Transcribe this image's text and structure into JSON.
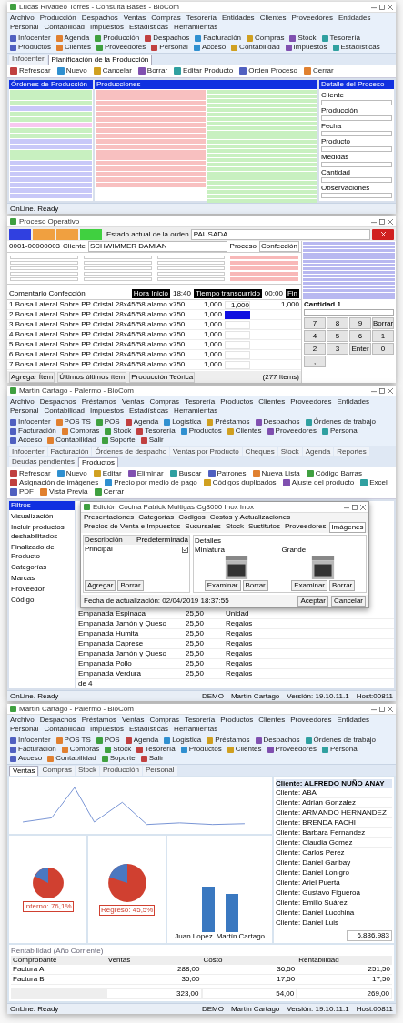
{
  "production_window": {
    "title": "Lucas Rivadeo Torres - Consulta Bases - BioCom",
    "menu": [
      "Archivo",
      "Producción",
      "Despachos",
      "Ventas",
      "Compras",
      "Tesorería",
      "Entidades",
      "Clientes",
      "Proveedores",
      "Entidades",
      "Personal",
      "Contabilidad",
      "Impuestos",
      "Estadísticas",
      "Herramientas"
    ],
    "toolbar": [
      "Infocenter",
      "Agenda",
      "Producción",
      "Despachos",
      "Facturación",
      "Compras",
      "Stock",
      "Tesorería",
      "Productos",
      "Clientes",
      "Proveedores",
      "Personal",
      "Acceso",
      "Contabilidad",
      "Impuestos",
      "Estadísticas"
    ],
    "tabs": [
      {
        "label": "Infocenter",
        "selected": false
      },
      {
        "label": "Planificación de la Producción",
        "selected": true
      }
    ],
    "ribbon": [
      "Refrescar",
      "Nuevo",
      "Cancelar",
      "Borrar",
      "Editar Producto",
      "Orden Proceso",
      "Cerrar"
    ],
    "panels": [
      "Órdenes de Producción",
      "Producciones",
      "Detalle del Proceso"
    ],
    "orders": [
      {
        "color": "#c8f0c0"
      },
      {
        "color": "#c8f0c0"
      },
      {
        "color": "#c8f0c0"
      },
      {
        "color": "#c8c8f8"
      },
      {
        "color": "#c8f0c0"
      },
      {
        "color": "#c8f0c0"
      },
      {
        "color": "#f8c8f0"
      },
      {
        "color": "#c8f0c0"
      },
      {
        "color": "#c8f0c0"
      },
      {
        "color": "#c8c8f8"
      },
      {
        "color": "#c8c8f8"
      },
      {
        "color": "#c8f0c0"
      },
      {
        "color": "#c8f0c0"
      },
      {
        "color": "#c8c8f8"
      },
      {
        "color": "#c8c8f8"
      },
      {
        "color": "#c8c8f8"
      },
      {
        "color": "#c8c8f8"
      },
      {
        "color": "#c8c8f8"
      },
      {
        "color": "#c8c8f8"
      },
      {
        "color": "#c8c8f8"
      }
    ],
    "detail_fields": [
      "Cliente",
      "Producción",
      "Fecha",
      "Producto",
      "Medidas",
      "Cantidad",
      "Observaciones"
    ],
    "status_bar": "OnLine. Ready"
  },
  "operative_window": {
    "title": "Proceso Operativo",
    "state_buttons": [
      {
        "color": "#3040e0"
      },
      {
        "color": "#f0a040"
      },
      {
        "color": "#f0a040"
      },
      {
        "color": "#40d040"
      }
    ],
    "state_label": "Estado actual de la orden",
    "state_value": "PAUSADA",
    "order": "0001-00000003",
    "client_label": "Cliente",
    "client": "SCHWIMMER DAMIAN",
    "process_label": "Proceso",
    "process": "Confección",
    "comment": "Comentario Confección",
    "start_label": "Hora Inicio",
    "start": "18:40",
    "elapsed_label": "Tiempo transcurrido",
    "elapsed": "00:00",
    "end_label": "Fin",
    "lines": [
      {
        "item": "1 Bolsa Lateral Sobre PP Cristal 28x45/58 alamo x750",
        "qty": "1,000",
        "done": "1,000",
        "total": "1,000",
        "selected": false
      },
      {
        "item": "2 Bolsa Lateral Sobre PP Cristal 28x45/58 alamo x750",
        "qty": "1,000",
        "selected": true
      },
      {
        "item": "3 Bolsa Lateral Sobre PP Cristal 28x45/58 alamo x750",
        "qty": "1,000",
        "selected": false
      },
      {
        "item": "4 Bolsa Lateral Sobre PP Cristal 28x45/58 alamo x750",
        "qty": "1,000",
        "selected": false
      },
      {
        "item": "5 Bolsa Lateral Sobre PP Cristal 28x45/58 alamo x750",
        "qty": "1,000",
        "selected": false
      },
      {
        "item": "6 Bolsa Lateral Sobre PP Cristal 28x45/58 alamo x750",
        "qty": "1,000",
        "selected": false
      },
      {
        "item": "7 Bolsa Lateral Sobre PP Cristal 28x45/58 alamo x750",
        "qty": "1,000",
        "selected": false
      }
    ],
    "footer_tabs": [
      "Agregar Ítem",
      "Últimos últimos ítem",
      "Producción Teórica"
    ],
    "item_count": "(277 Items)",
    "keypad_label": "Cantidad 1",
    "keys": [
      "7",
      "8",
      "9",
      "Borrar",
      "4",
      "5",
      "6",
      "1",
      "2",
      "3",
      "Enter",
      "0",
      ","
    ]
  },
  "products_window": {
    "title": "Martín Cartago - Palermo - BioCom",
    "menu": [
      "Archivo",
      "Despachos",
      "Préstamos",
      "Ventas",
      "Compras",
      "Tesorería",
      "Productos",
      "Clientes",
      "Proveedores",
      "Entidades",
      "Personal",
      "Contabilidad",
      "Impuestos",
      "Estadísticas",
      "Herramientas"
    ],
    "toolbar": [
      "Infocenter",
      "POS TS",
      "POS",
      "Agenda",
      "Logística",
      "Préstamos",
      "Despachos",
      "Órdenes de trabajo",
      "Facturación",
      "Compras",
      "Stock",
      "Tesorería",
      "Productos",
      "Clientes",
      "Proveedores",
      "Personal",
      "Acceso",
      "Contabilidad",
      "Soporte",
      "Salir"
    ],
    "tabs": [
      {
        "label": "Infocenter",
        "selected": false
      },
      {
        "label": "Facturación",
        "selected": false
      },
      {
        "label": "Órdenes de despacho",
        "selected": false
      },
      {
        "label": "Ventas por Producto",
        "selected": false
      },
      {
        "label": "Cheques",
        "selected": false
      },
      {
        "label": "Stock",
        "selected": false
      },
      {
        "label": "Agenda",
        "selected": false
      },
      {
        "label": "Reportes",
        "selected": false
      },
      {
        "label": "Deudas pendientes",
        "selected": false
      },
      {
        "label": "Productos",
        "selected": true
      }
    ],
    "ribbon": [
      "Refrescar",
      "Nuevo",
      "Editar",
      "Eliminar",
      "Buscar",
      "Patrones",
      "Nueva Lista",
      "Código Barras",
      "Asignación de imágenes",
      "Precio por medio de pago",
      "Códigos duplicados",
      "Ajuste del producto",
      "Excel",
      "PDF",
      "Vista Previa",
      "Cerrar"
    ],
    "filters": [
      "Filtros",
      "Visualización",
      "Incluir productos deshabilitados",
      "Finalizado del Producto",
      "Categorías",
      "Marcas",
      "Proveedor",
      "Código"
    ],
    "dialog": {
      "title": "Edición Cocina Patrick Multigas Cg8050 Inox Inox",
      "tabs": [
        {
          "label": "Presentaciones",
          "selected": false
        },
        {
          "label": "Categorías",
          "selected": false
        },
        {
          "label": "Códigos",
          "selected": false
        },
        {
          "label": "Costos y Actualizaciones",
          "selected": false
        },
        {
          "label": "Precios de Venta e Impuestos",
          "selected": false
        },
        {
          "label": "Sucursales",
          "selected": false
        },
        {
          "label": "Stock",
          "selected": false
        },
        {
          "label": "Sustitutos",
          "selected": false
        },
        {
          "label": "Proveedores",
          "selected": false
        },
        {
          "label": "Imágenes",
          "selected": true
        }
      ],
      "list_headers": [
        "Descripción",
        "Predeterminada"
      ],
      "list_item": "Principal",
      "default": true,
      "images_title": "Detalles",
      "images": [
        "Miniatura",
        "Grande"
      ],
      "image_buttons": [
        [
          "Examinar",
          "Borrar"
        ],
        [
          "Examinar",
          "Borrar"
        ]
      ],
      "list_buttons": [
        "Agregar",
        "Borrar"
      ],
      "updated": "Fecha de actualización: 02/04/2019 18:37:55",
      "buttons": [
        "Aceptar",
        "Cancelar"
      ]
    },
    "rows": [
      [
        "Empanada Espinaca",
        "25,50",
        "Unidad"
      ],
      [
        "Empanada Jamón y Queso",
        "25,50",
        "Regalos"
      ],
      [
        "Empanada Humita",
        "25,50",
        "Regalos"
      ],
      [
        "Empanada Caprese",
        "25,50",
        "Regalos"
      ],
      [
        "Empanada Jamón y Queso",
        "25,50",
        "Regalos"
      ],
      [
        "Empanada Pollo",
        "25,50",
        "Regalos"
      ],
      [
        "Empanada Verdura",
        "25,50",
        "Regalos"
      ]
    ],
    "page": "de 4",
    "status": [
      "OnLine. Ready",
      "DEMO",
      "Martín Cartago",
      "Versión: 19.10.11.1",
      "Host:00811"
    ]
  },
  "dashboard_window": {
    "title": "Martín Cartago - Palermo - BioCom",
    "menu": [
      "Archivo",
      "Despachos",
      "Préstamos",
      "Ventas",
      "Compras",
      "Tesorería",
      "Productos",
      "Clientes",
      "Proveedores",
      "Entidades",
      "Personal",
      "Contabilidad",
      "Impuestos",
      "Estadísticas",
      "Herramientas"
    ],
    "toolbar": [
      "Infocenter",
      "POS TS",
      "POS",
      "Agenda",
      "Logística",
      "Préstamos",
      "Despachos",
      "Órdenes de trabajo",
      "Facturación",
      "Compras",
      "Stock",
      "Tesorería",
      "Productos",
      "Clientes",
      "Proveedores",
      "Personal",
      "Acceso",
      "Contabilidad",
      "Soporte",
      "Salir"
    ],
    "tabs": [
      {
        "label": "Ventas",
        "selected": true
      },
      {
        "label": "Compras",
        "selected": false
      },
      {
        "label": "Stock",
        "selected": false
      },
      {
        "label": "Producción",
        "selected": false
      },
      {
        "label": "Personal",
        "selected": false
      }
    ],
    "pie_labels": [
      "Interno: 76,1%",
      "Regreso: 45,5%"
    ],
    "bar_labels": [
      "Juan Lopez",
      "Martín Cartago"
    ],
    "clients": [
      "Cliente: ALFREDO NUÑO ANAY",
      "Cliente: ABA",
      "Cliente: Adrian Gonzalez",
      "Cliente: ARMANDO HERNANDEZ",
      "Cliente: BRENDA FACHI",
      "Cliente: Barbara Fernandez",
      "Cliente: Claudia Gomez",
      "Cliente: Carlos Perez",
      "Cliente: Daniel Garibay",
      "Cliente: Daniel Lonigro",
      "Cliente: Ariel Puerta",
      "Cliente: Gustavo Figueroa",
      "Cliente: Emilio Suárez",
      "Cliente: Daniel Lucchina",
      "Cliente: Daniel Luis"
    ],
    "clients_total": "6.886.983",
    "profit_title": "Rentabilidad (Año Corriente)",
    "columns": [
      "Comprobante",
      "Ventas",
      "Costo",
      "Rentabilidad"
    ],
    "rows": [
      [
        "Factura A",
        "288,00",
        "36,50",
        "251,50"
      ],
      [
        "Factura B",
        "35,00",
        "17,50",
        "17,50"
      ]
    ],
    "totals": [
      "323,00",
      "54,00",
      "269,00"
    ],
    "status": [
      "OnLine. Ready",
      "DEMO",
      "Martín Cartago",
      "Versión: 19.10.11.1",
      "Host:00811"
    ]
  }
}
